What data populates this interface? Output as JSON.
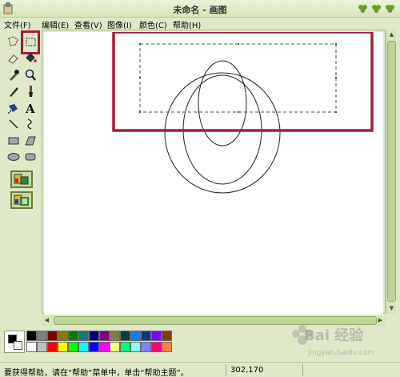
{
  "window": {
    "title": "未命名 - 画图"
  },
  "menu": [
    {
      "label": "文件(F)"
    },
    {
      "label": "编辑(E)"
    },
    {
      "label": "查看(V)"
    },
    {
      "label": "图像(I)"
    },
    {
      "label": "颜色(C)"
    },
    {
      "label": "帮助(H)"
    }
  ],
  "toolbox": {
    "tools": [
      {
        "name": "free-form-select-icon"
      },
      {
        "name": "rectangle-select-icon",
        "selected": true
      },
      {
        "name": "eraser-icon"
      },
      {
        "name": "fill-bucket-icon"
      },
      {
        "name": "pick-color-icon"
      },
      {
        "name": "magnifier-icon"
      },
      {
        "name": "pencil-icon"
      },
      {
        "name": "brush-icon"
      },
      {
        "name": "airbrush-icon"
      },
      {
        "name": "text-icon"
      },
      {
        "name": "line-icon"
      },
      {
        "name": "curve-icon"
      },
      {
        "name": "rectangle-icon"
      },
      {
        "name": "polygon-icon"
      },
      {
        "name": "ellipse-icon"
      },
      {
        "name": "rounded-rectangle-icon"
      }
    ],
    "text_tool_glyph": "A",
    "highlight_color": "#a51c3a"
  },
  "palette": {
    "foreground": "#000000",
    "background": "#ffffff",
    "colors_top": [
      "#000000",
      "#808080",
      "#800000",
      "#808000",
      "#008000",
      "#008080",
      "#000080",
      "#800080",
      "#808040",
      "#004040",
      "#0080ff",
      "#004080",
      "#8000ff",
      "#804000"
    ],
    "colors_bottom": [
      "#ffffff",
      "#c0c0c0",
      "#ff0000",
      "#ffff00",
      "#00ff00",
      "#00ffff",
      "#0000ff",
      "#ff00ff",
      "#ffff80",
      "#00ff80",
      "#80ffff",
      "#8080ff",
      "#ff0080",
      "#ff8040"
    ]
  },
  "status": {
    "help_text": "要获得帮助，请在“帮助”菜单中，单击“帮助主题”。",
    "coords": "302,170"
  },
  "watermark": {
    "text": "Bai 经验",
    "sub": "jingyan.baidu.com"
  }
}
